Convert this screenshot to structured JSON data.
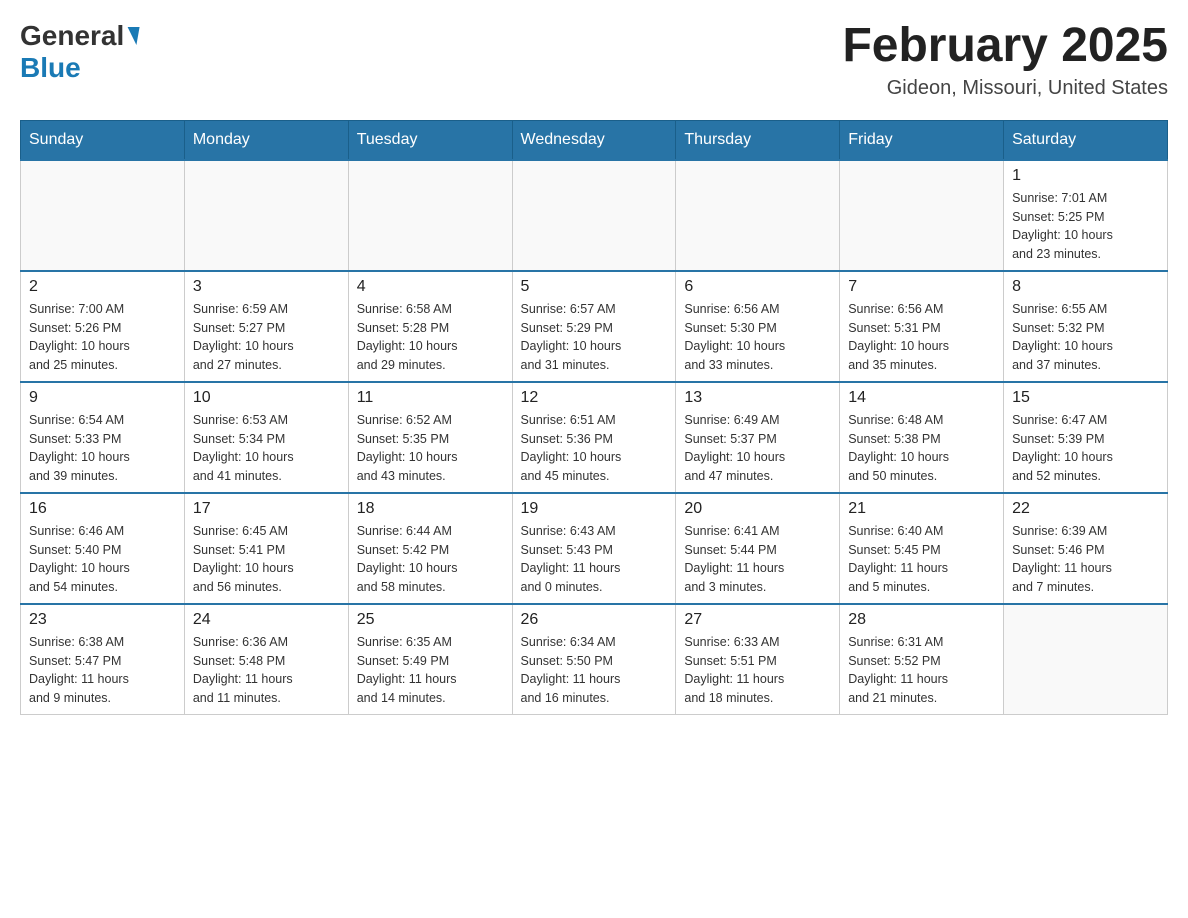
{
  "header": {
    "logo_general": "General",
    "logo_blue": "Blue",
    "month_year": "February 2025",
    "location": "Gideon, Missouri, United States"
  },
  "days_of_week": [
    "Sunday",
    "Monday",
    "Tuesday",
    "Wednesday",
    "Thursday",
    "Friday",
    "Saturday"
  ],
  "weeks": [
    [
      {
        "day": "",
        "info": ""
      },
      {
        "day": "",
        "info": ""
      },
      {
        "day": "",
        "info": ""
      },
      {
        "day": "",
        "info": ""
      },
      {
        "day": "",
        "info": ""
      },
      {
        "day": "",
        "info": ""
      },
      {
        "day": "1",
        "info": "Sunrise: 7:01 AM\nSunset: 5:25 PM\nDaylight: 10 hours\nand 23 minutes."
      }
    ],
    [
      {
        "day": "2",
        "info": "Sunrise: 7:00 AM\nSunset: 5:26 PM\nDaylight: 10 hours\nand 25 minutes."
      },
      {
        "day": "3",
        "info": "Sunrise: 6:59 AM\nSunset: 5:27 PM\nDaylight: 10 hours\nand 27 minutes."
      },
      {
        "day": "4",
        "info": "Sunrise: 6:58 AM\nSunset: 5:28 PM\nDaylight: 10 hours\nand 29 minutes."
      },
      {
        "day": "5",
        "info": "Sunrise: 6:57 AM\nSunset: 5:29 PM\nDaylight: 10 hours\nand 31 minutes."
      },
      {
        "day": "6",
        "info": "Sunrise: 6:56 AM\nSunset: 5:30 PM\nDaylight: 10 hours\nand 33 minutes."
      },
      {
        "day": "7",
        "info": "Sunrise: 6:56 AM\nSunset: 5:31 PM\nDaylight: 10 hours\nand 35 minutes."
      },
      {
        "day": "8",
        "info": "Sunrise: 6:55 AM\nSunset: 5:32 PM\nDaylight: 10 hours\nand 37 minutes."
      }
    ],
    [
      {
        "day": "9",
        "info": "Sunrise: 6:54 AM\nSunset: 5:33 PM\nDaylight: 10 hours\nand 39 minutes."
      },
      {
        "day": "10",
        "info": "Sunrise: 6:53 AM\nSunset: 5:34 PM\nDaylight: 10 hours\nand 41 minutes."
      },
      {
        "day": "11",
        "info": "Sunrise: 6:52 AM\nSunset: 5:35 PM\nDaylight: 10 hours\nand 43 minutes."
      },
      {
        "day": "12",
        "info": "Sunrise: 6:51 AM\nSunset: 5:36 PM\nDaylight: 10 hours\nand 45 minutes."
      },
      {
        "day": "13",
        "info": "Sunrise: 6:49 AM\nSunset: 5:37 PM\nDaylight: 10 hours\nand 47 minutes."
      },
      {
        "day": "14",
        "info": "Sunrise: 6:48 AM\nSunset: 5:38 PM\nDaylight: 10 hours\nand 50 minutes."
      },
      {
        "day": "15",
        "info": "Sunrise: 6:47 AM\nSunset: 5:39 PM\nDaylight: 10 hours\nand 52 minutes."
      }
    ],
    [
      {
        "day": "16",
        "info": "Sunrise: 6:46 AM\nSunset: 5:40 PM\nDaylight: 10 hours\nand 54 minutes."
      },
      {
        "day": "17",
        "info": "Sunrise: 6:45 AM\nSunset: 5:41 PM\nDaylight: 10 hours\nand 56 minutes."
      },
      {
        "day": "18",
        "info": "Sunrise: 6:44 AM\nSunset: 5:42 PM\nDaylight: 10 hours\nand 58 minutes."
      },
      {
        "day": "19",
        "info": "Sunrise: 6:43 AM\nSunset: 5:43 PM\nDaylight: 11 hours\nand 0 minutes."
      },
      {
        "day": "20",
        "info": "Sunrise: 6:41 AM\nSunset: 5:44 PM\nDaylight: 11 hours\nand 3 minutes."
      },
      {
        "day": "21",
        "info": "Sunrise: 6:40 AM\nSunset: 5:45 PM\nDaylight: 11 hours\nand 5 minutes."
      },
      {
        "day": "22",
        "info": "Sunrise: 6:39 AM\nSunset: 5:46 PM\nDaylight: 11 hours\nand 7 minutes."
      }
    ],
    [
      {
        "day": "23",
        "info": "Sunrise: 6:38 AM\nSunset: 5:47 PM\nDaylight: 11 hours\nand 9 minutes."
      },
      {
        "day": "24",
        "info": "Sunrise: 6:36 AM\nSunset: 5:48 PM\nDaylight: 11 hours\nand 11 minutes."
      },
      {
        "day": "25",
        "info": "Sunrise: 6:35 AM\nSunset: 5:49 PM\nDaylight: 11 hours\nand 14 minutes."
      },
      {
        "day": "26",
        "info": "Sunrise: 6:34 AM\nSunset: 5:50 PM\nDaylight: 11 hours\nand 16 minutes."
      },
      {
        "day": "27",
        "info": "Sunrise: 6:33 AM\nSunset: 5:51 PM\nDaylight: 11 hours\nand 18 minutes."
      },
      {
        "day": "28",
        "info": "Sunrise: 6:31 AM\nSunset: 5:52 PM\nDaylight: 11 hours\nand 21 minutes."
      },
      {
        "day": "",
        "info": ""
      }
    ]
  ]
}
